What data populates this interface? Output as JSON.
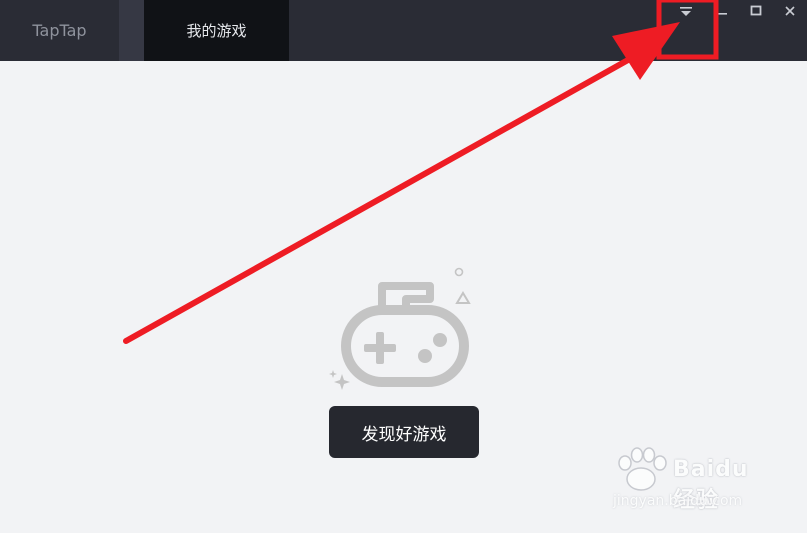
{
  "titlebar": {
    "tabs": [
      {
        "label": "TapTap"
      },
      {
        "label": "我的游戏"
      }
    ],
    "icons": [
      "menu-dropdown-icon",
      "minimize-icon",
      "maximize-icon",
      "close-icon"
    ]
  },
  "main": {
    "illustration_icon": "gamepad-icon",
    "discover_button_label": "发现好游戏"
  },
  "annotation": {
    "color": "#ee1c24",
    "type": "arrow-and-box"
  },
  "watermark": {
    "brand": "Baidu经验",
    "url": "jingyan.baidu.com"
  },
  "colors": {
    "titlebar_bg": "#2a2c35",
    "active_tab_bg": "#101216",
    "content_bg": "#f2f3f5",
    "button_bg": "#26282f",
    "illustration": "#c4c4c4"
  }
}
